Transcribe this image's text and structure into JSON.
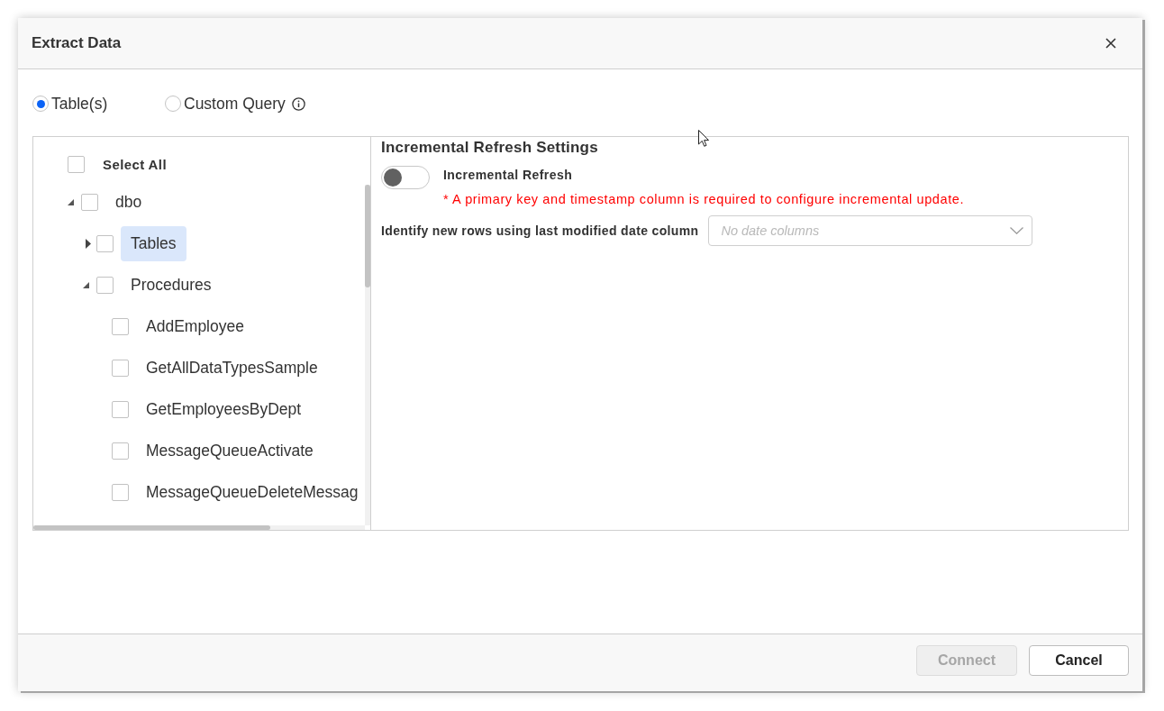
{
  "dialog": {
    "title": "Extract Data"
  },
  "source_options": [
    {
      "label": "Table(s)",
      "selected": true,
      "info": false
    },
    {
      "label": "Custom Query",
      "selected": false,
      "info": true
    }
  ],
  "tree": {
    "select_all": {
      "label": "Select All",
      "checked": false
    },
    "nodes": [
      {
        "kind": "group",
        "label": "dbo",
        "checked": false,
        "expanded": true,
        "selected": false,
        "children": [
          {
            "kind": "group",
            "label": "Tables",
            "checked": false,
            "expanded": false,
            "selected": true
          },
          {
            "kind": "group",
            "label": "Procedures",
            "checked": false,
            "expanded": true,
            "selected": false,
            "children": [
              {
                "kind": "item",
                "label": "AddEmployee",
                "checked": false,
                "selected": false
              },
              {
                "kind": "item",
                "label": "GetAllDataTypesSample",
                "checked": false,
                "selected": false
              },
              {
                "kind": "item",
                "label": "GetEmployeesByDept",
                "checked": false,
                "selected": false
              },
              {
                "kind": "item",
                "label": "MessageQueueActivate",
                "checked": false,
                "selected": false
              },
              {
                "kind": "item",
                "label": "MessageQueueDeleteMessag",
                "checked": false,
                "selected": false
              }
            ]
          }
        ]
      }
    ]
  },
  "settings": {
    "title": "Incremental Refresh Settings",
    "toggle": {
      "label": "Incremental Refresh",
      "on": false
    },
    "warning": "* A primary key and timestamp column is required to configure incremental update.",
    "date_column": {
      "label": "Identify new rows using last modified date column",
      "placeholder": "No date columns"
    }
  },
  "footer": {
    "buttons": [
      {
        "label": "Connect",
        "disabled": true
      },
      {
        "label": "Cancel",
        "disabled": false
      }
    ]
  }
}
